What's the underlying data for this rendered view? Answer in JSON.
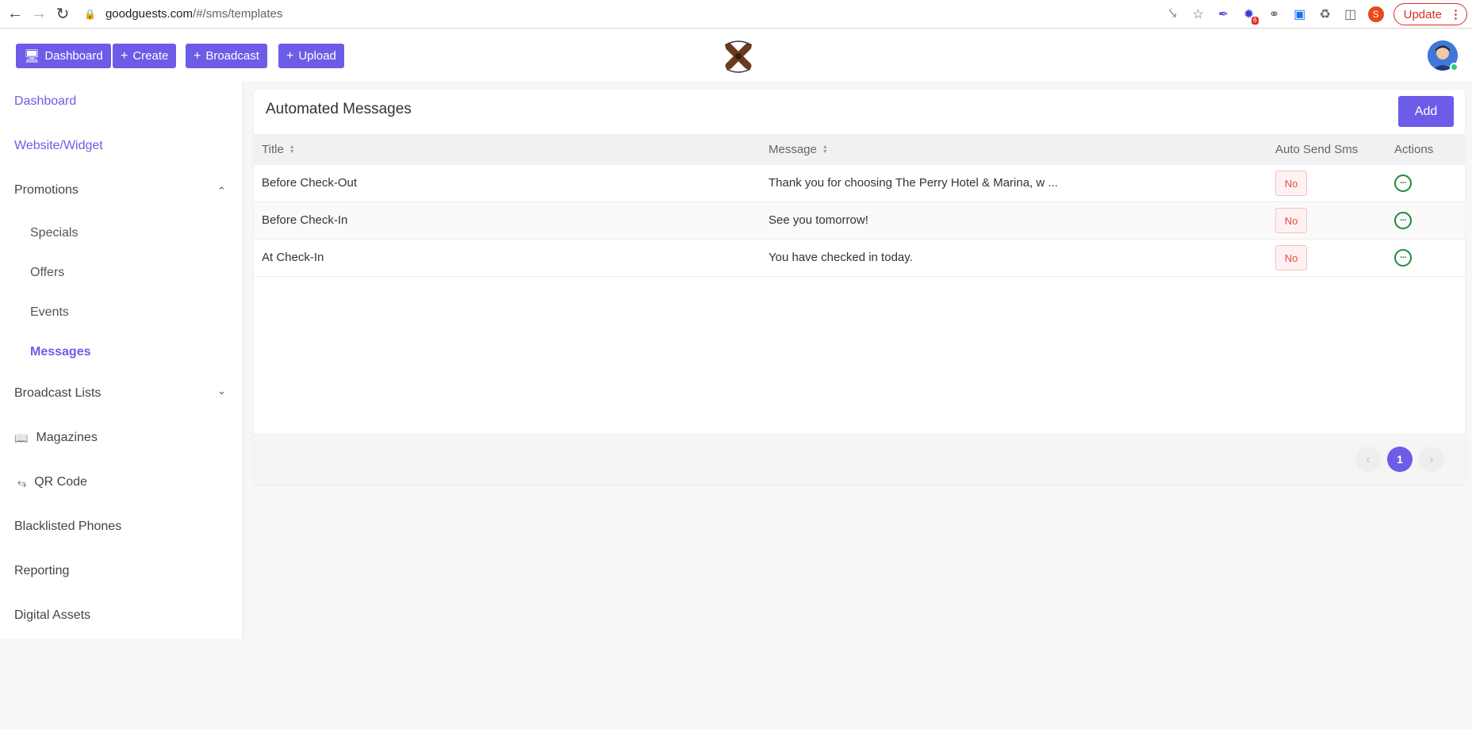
{
  "browser": {
    "url_host": "goodguests.com",
    "url_path": "/#/sms/templates",
    "update_label": "Update",
    "profile_initial": "S",
    "ext_badge": "6"
  },
  "header": {
    "buttons": [
      {
        "label": "Dashboard",
        "icon": "monitor-icon"
      },
      {
        "label": "Create",
        "icon": "plus-icon"
      },
      {
        "label": "Broadcast",
        "icon": "plus-icon"
      },
      {
        "label": "Upload",
        "icon": "plus-icon"
      }
    ],
    "accent": "#6c5ce7"
  },
  "sidebar": {
    "dashboard": "Dashboard",
    "website_widget": "Website/Widget",
    "promotions": "Promotions",
    "specials": "Specials",
    "offers": "Offers",
    "events": "Events",
    "messages": "Messages",
    "broadcast_lists": "Broadcast Lists",
    "magazines": "Magazines",
    "qr_code": "QR Code",
    "blacklisted_phones": "Blacklisted Phones",
    "reporting": "Reporting",
    "digital_assets": "Digital Assets"
  },
  "main": {
    "title": "Automated Messages",
    "add_label": "Add",
    "columns": {
      "title": "Title",
      "message": "Message",
      "auto_send": "Auto Send Sms",
      "actions": "Actions"
    },
    "rows": [
      {
        "title": "Before Check-Out",
        "message": "Thank you for choosing The Perry Hotel & Marina, w ...",
        "auto_send": "No"
      },
      {
        "title": "Before Check-In",
        "message": "See you tomorrow!",
        "auto_send": "No"
      },
      {
        "title": "At Check-In",
        "message": "You have checked in today.",
        "auto_send": "No"
      }
    ],
    "pagination": {
      "current": "1",
      "prev": "‹",
      "next": "›"
    },
    "status_color": "#e74c3c",
    "action_color": "#1e8a3c"
  }
}
